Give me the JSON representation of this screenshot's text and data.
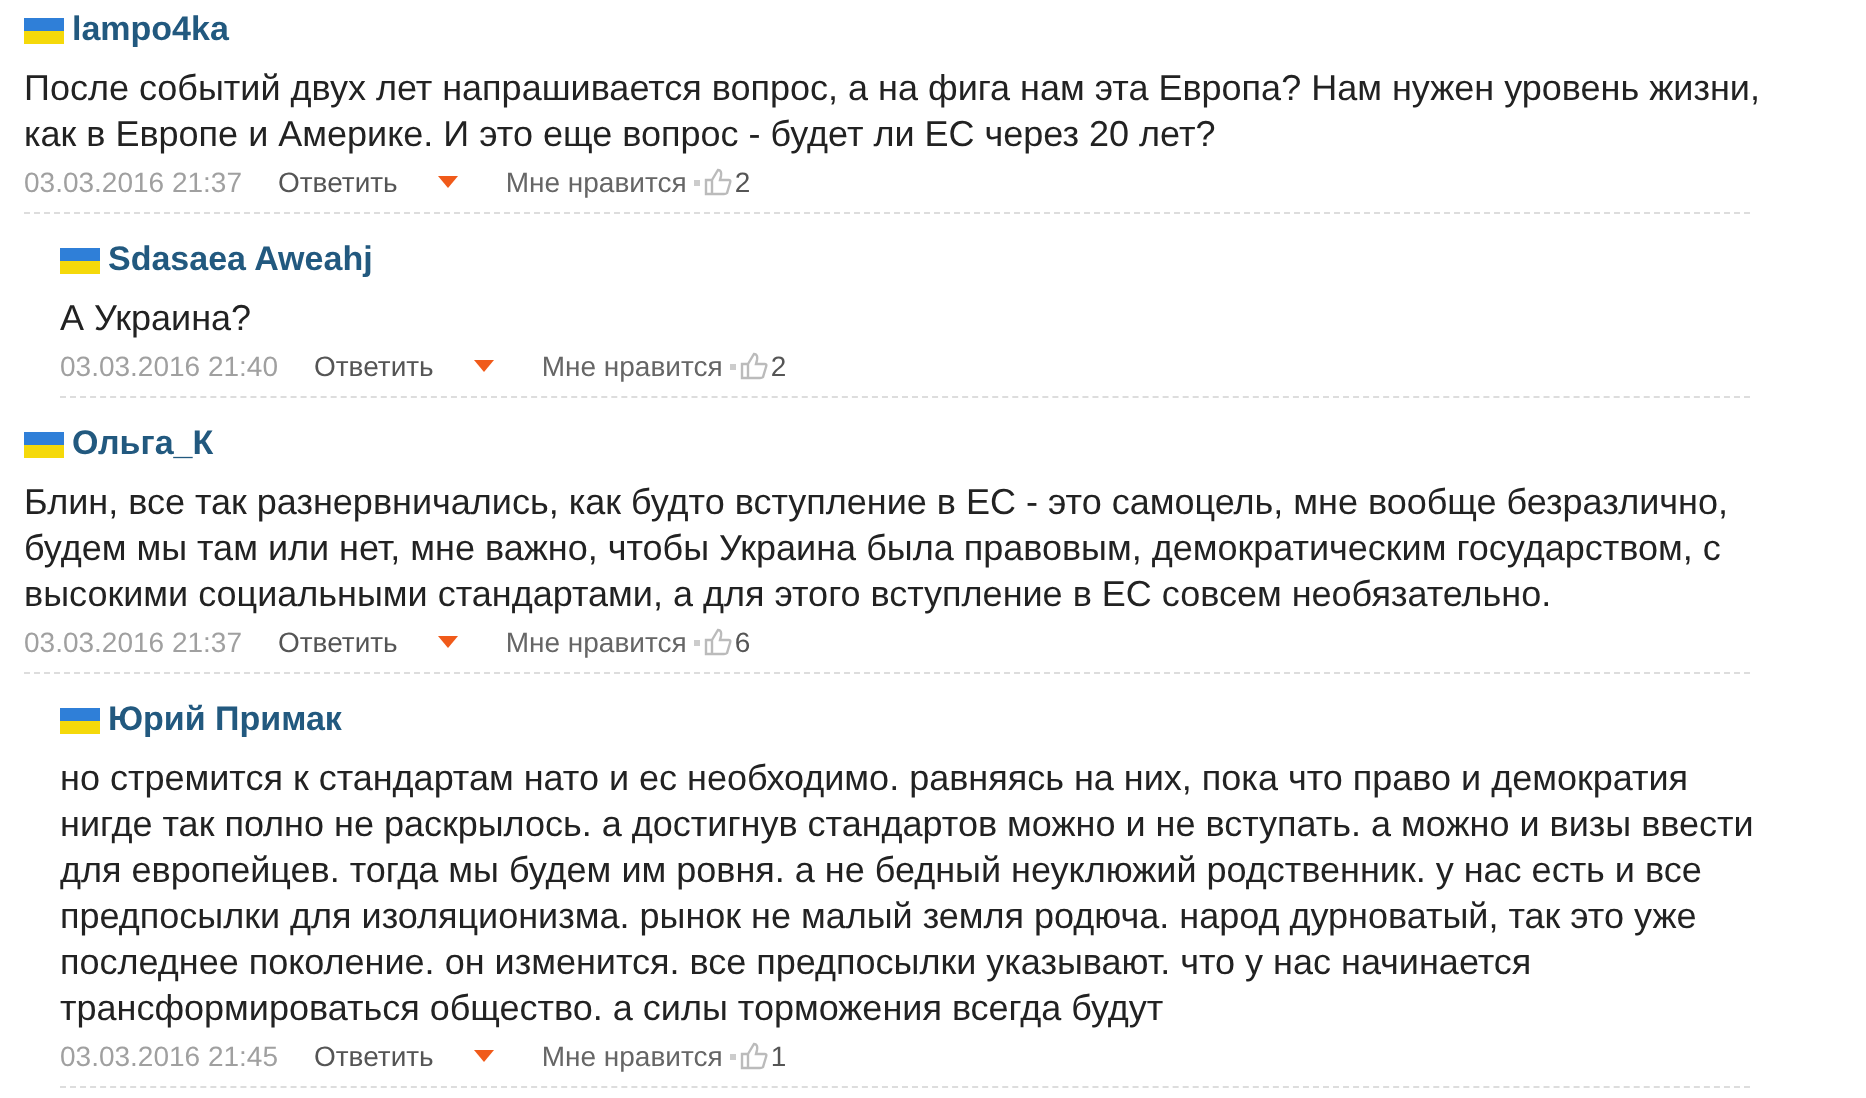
{
  "comments": [
    {
      "author": "lampo4ka",
      "reply": false,
      "text": "После событий двух лет напрашивается вопрос, а на фига нам эта Европа? Нам нужен уровень жизни, как в Европе и Америке. И это еще вопрос - будет ли ЕС через 20 лет?",
      "date": "03.03.2016 21:37",
      "reply_label": "Ответить",
      "like_label": "Мне нравится",
      "likes": "2"
    },
    {
      "author": "Sdasaea Aweahj",
      "reply": true,
      "text": "А Украина?",
      "date": "03.03.2016 21:40",
      "reply_label": "Ответить",
      "like_label": "Мне нравится",
      "likes": "2"
    },
    {
      "author": "Ольга_К",
      "reply": false,
      "text": "Блин, все так разнервничались, как будто вступление в ЕС - это самоцель, мне вообще безразлично, будем мы там или нет, мне важно, чтобы Украина была правовым, демократическим государством, с высокими социальными стандартами, а для этого вступление в ЕС совсем необязательно.",
      "date": "03.03.2016 21:37",
      "reply_label": "Ответить",
      "like_label": "Мне нравится",
      "likes": "6"
    },
    {
      "author": "Юрий Примак",
      "reply": true,
      "text": "но стремится к стандартам нато и ес необходимо. равняясь на них, пока что право и демократия нигде так полно не раскрылось. а достигнув стандартов можно и не вступать. а можно и визы ввести для европейцев. тогда мы будем им ровня. а не бедный неуклюжий родственник. у нас есть и все предпосылки для изоляционизма. рынок не малый земля родюча. народ дурноватый, так это уже последнее поколение. он изменится. все предпосылки указывают. что у нас начинается трансформироваться общество. а силы торможения всегда будут",
      "date": "03.03.2016 21:45",
      "reply_label": "Ответить",
      "like_label": "Мне нравится",
      "likes": "1"
    }
  ]
}
